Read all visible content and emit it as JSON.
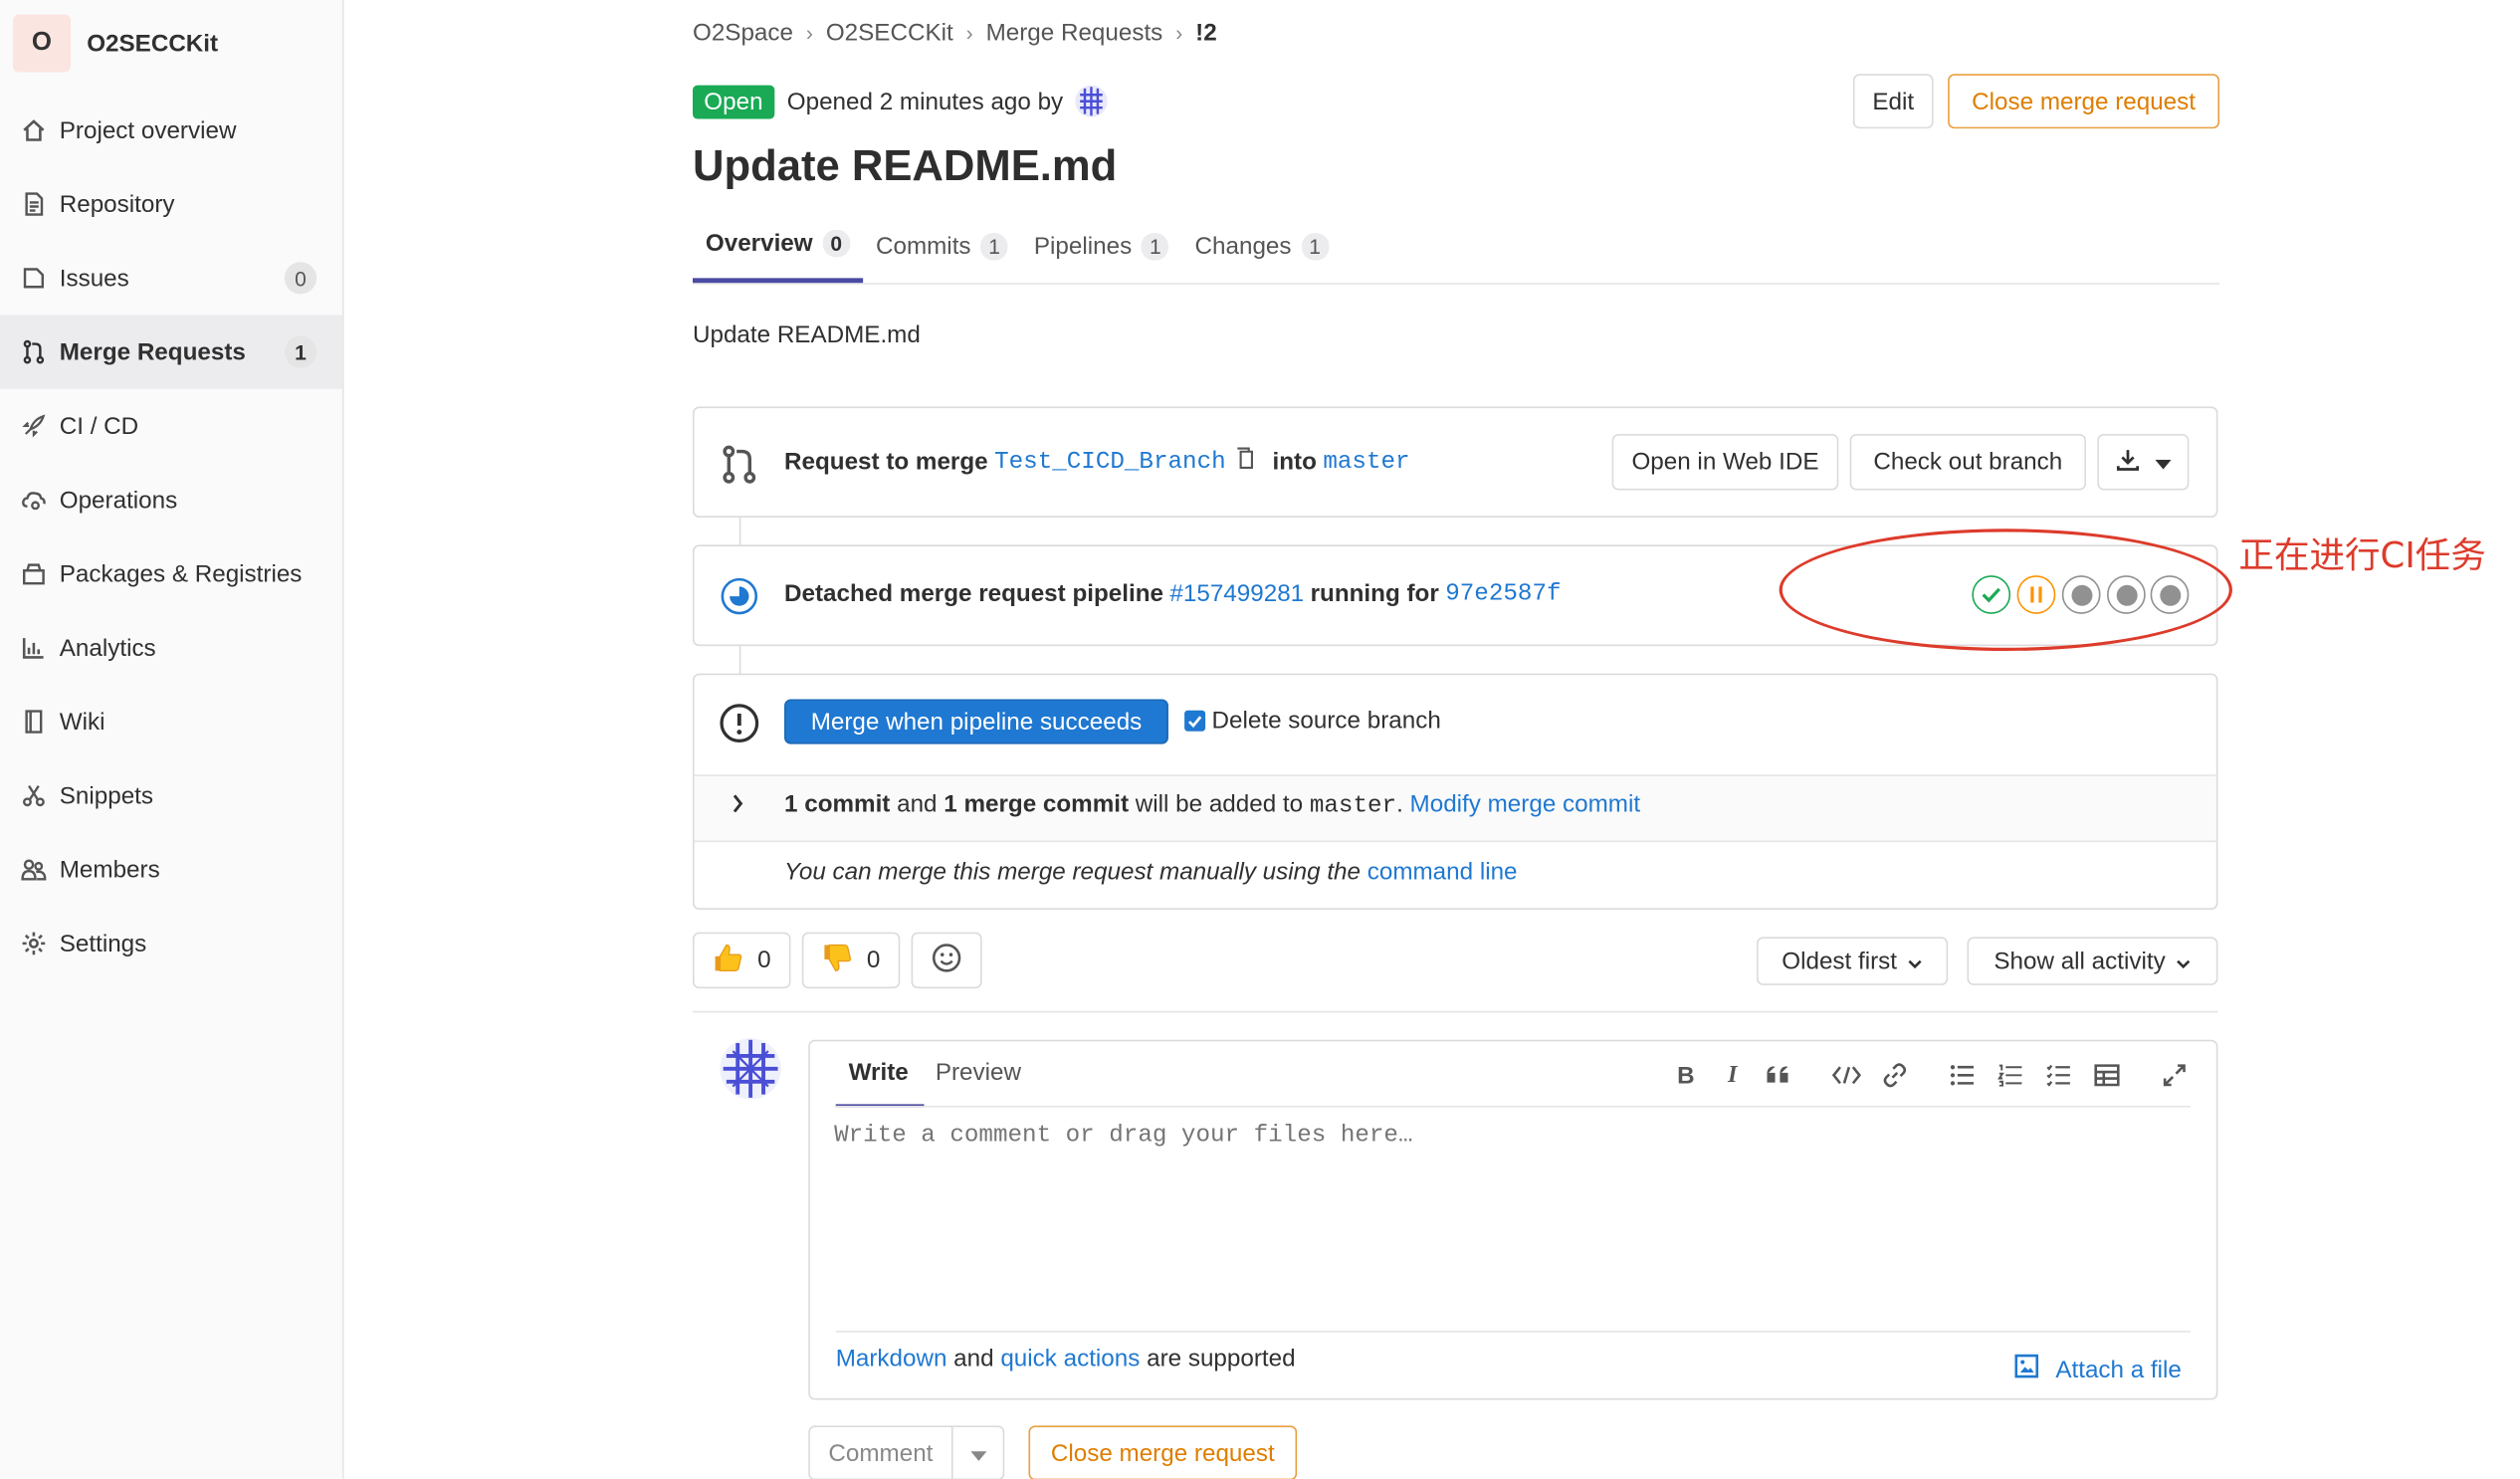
{
  "project": {
    "avatar_letter": "O",
    "name": "O2SECCKit"
  },
  "sidebar": {
    "items": [
      {
        "label": "Project overview"
      },
      {
        "label": "Repository"
      },
      {
        "label": "Issues",
        "badge": "0"
      },
      {
        "label": "Merge Requests",
        "badge": "1"
      },
      {
        "label": "CI / CD"
      },
      {
        "label": "Operations"
      },
      {
        "label": "Packages & Registries"
      },
      {
        "label": "Analytics"
      },
      {
        "label": "Wiki"
      },
      {
        "label": "Snippets"
      },
      {
        "label": "Members"
      },
      {
        "label": "Settings"
      }
    ]
  },
  "breadcrumb": [
    "O2Space",
    "O2SECCKit",
    "Merge Requests",
    "!2"
  ],
  "header": {
    "status": "Open",
    "opened_text": "Opened 2 minutes ago by",
    "edit_label": "Edit",
    "close_label": "Close merge request",
    "title": "Update README.md"
  },
  "tabs": [
    {
      "label": "Overview",
      "count": "0"
    },
    {
      "label": "Commits",
      "count": "1"
    },
    {
      "label": "Pipelines",
      "count": "1"
    },
    {
      "label": "Changes",
      "count": "1"
    }
  ],
  "description": "Update README.md",
  "merge_info": {
    "request_to_merge": "Request to merge",
    "source_branch": "Test_CICD_Branch",
    "into": "into",
    "target_branch": "master",
    "web_ide_label": "Open in Web IDE",
    "checkout_label": "Check out branch"
  },
  "pipeline": {
    "prefix": "Detached merge request pipeline",
    "id": "#157499281",
    "running_for": "running for",
    "sha": "97e2587f",
    "stages": [
      "success",
      "manual",
      "created",
      "created",
      "created"
    ]
  },
  "annotation": {
    "text": "正在进行CI任务"
  },
  "merge": {
    "button_label": "Merge when pipeline succeeds",
    "delete_source_label": "Delete source branch",
    "delete_source_checked": true,
    "commit_count": "1 commit",
    "and": "and",
    "merge_commit": "1 merge commit",
    "added_to": "will be added to",
    "target": "master",
    "modify_link": "Modify merge commit",
    "manual_text": "You can merge this merge request manually using the",
    "command_line_link": "command line"
  },
  "awards": {
    "thumbsup": "0",
    "thumbsdown": "0"
  },
  "sort": {
    "order_label": "Oldest first",
    "filter_label": "Show all activity"
  },
  "editor": {
    "write_tab": "Write",
    "preview_tab": "Preview",
    "placeholder": "Write a comment or drag your files here…",
    "markdown_link": "Markdown",
    "and": "and",
    "quick_actions_link": "quick actions",
    "supported": "are supported",
    "attach_label": "Attach a file"
  },
  "footer": {
    "comment_label": "Comment",
    "close_label": "Close merge request"
  },
  "colors": {
    "accent": "#1f78d1",
    "open": "#1aaa55",
    "warning": "#de7e00",
    "annotation": "#dd3b2b"
  }
}
